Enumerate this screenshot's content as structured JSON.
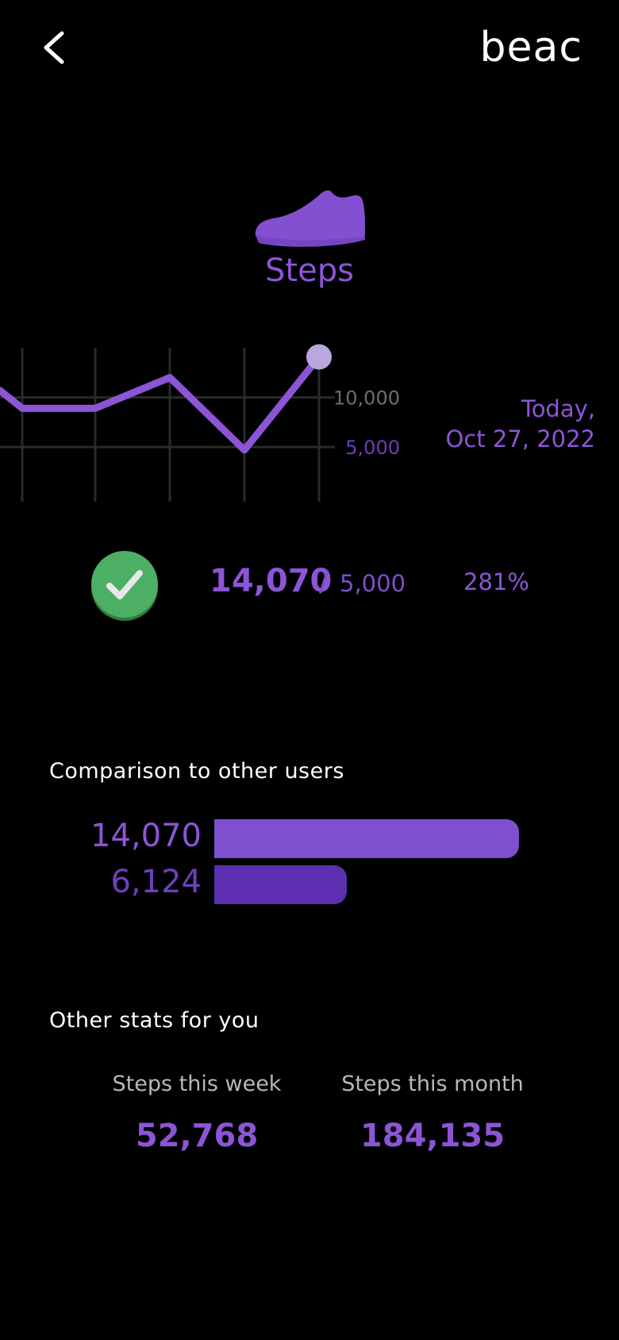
{
  "header": {
    "back_icon": "chevron-left-icon",
    "brand": "beac"
  },
  "hero": {
    "icon": "shoe-icon",
    "title": "Steps"
  },
  "chart_data": {
    "type": "line",
    "title": "",
    "xlabel": "",
    "ylabel": "",
    "y_tick_labels": [
      "10,000",
      "5,000"
    ],
    "y_ticks": [
      10000,
      5000
    ],
    "ylim": [
      -500,
      15000
    ],
    "grid": true,
    "series": [
      {
        "values": [
          10700,
          8900,
          8900,
          12000,
          4700,
          14070
        ]
      }
    ],
    "highlight_last_point": true
  },
  "date_label": {
    "line1": "Today,",
    "line2": "Oct 27, 2022"
  },
  "goal": {
    "status_icon": "check-circle-icon",
    "steps": "14,070",
    "separator": "/",
    "target": "5,000",
    "percent": "281%",
    "progress_percent": 281
  },
  "comparison": {
    "heading": "Comparison to other users",
    "user_value_label": "14,070",
    "user_value": 14070,
    "others_value_label": "6,124",
    "others_value": 6124
  },
  "other_stats": {
    "heading": "Other stats for you",
    "items": [
      {
        "label": "Steps this week",
        "value": "52,768"
      },
      {
        "label": "Steps this month",
        "value": "184,135"
      }
    ]
  },
  "colors": {
    "accent": "#8c55d6",
    "accent_dark": "#5c2fb0",
    "success": "#4caf64",
    "background": "#000000",
    "grid": "#2a2a2a",
    "point": "#b9a7dd"
  }
}
